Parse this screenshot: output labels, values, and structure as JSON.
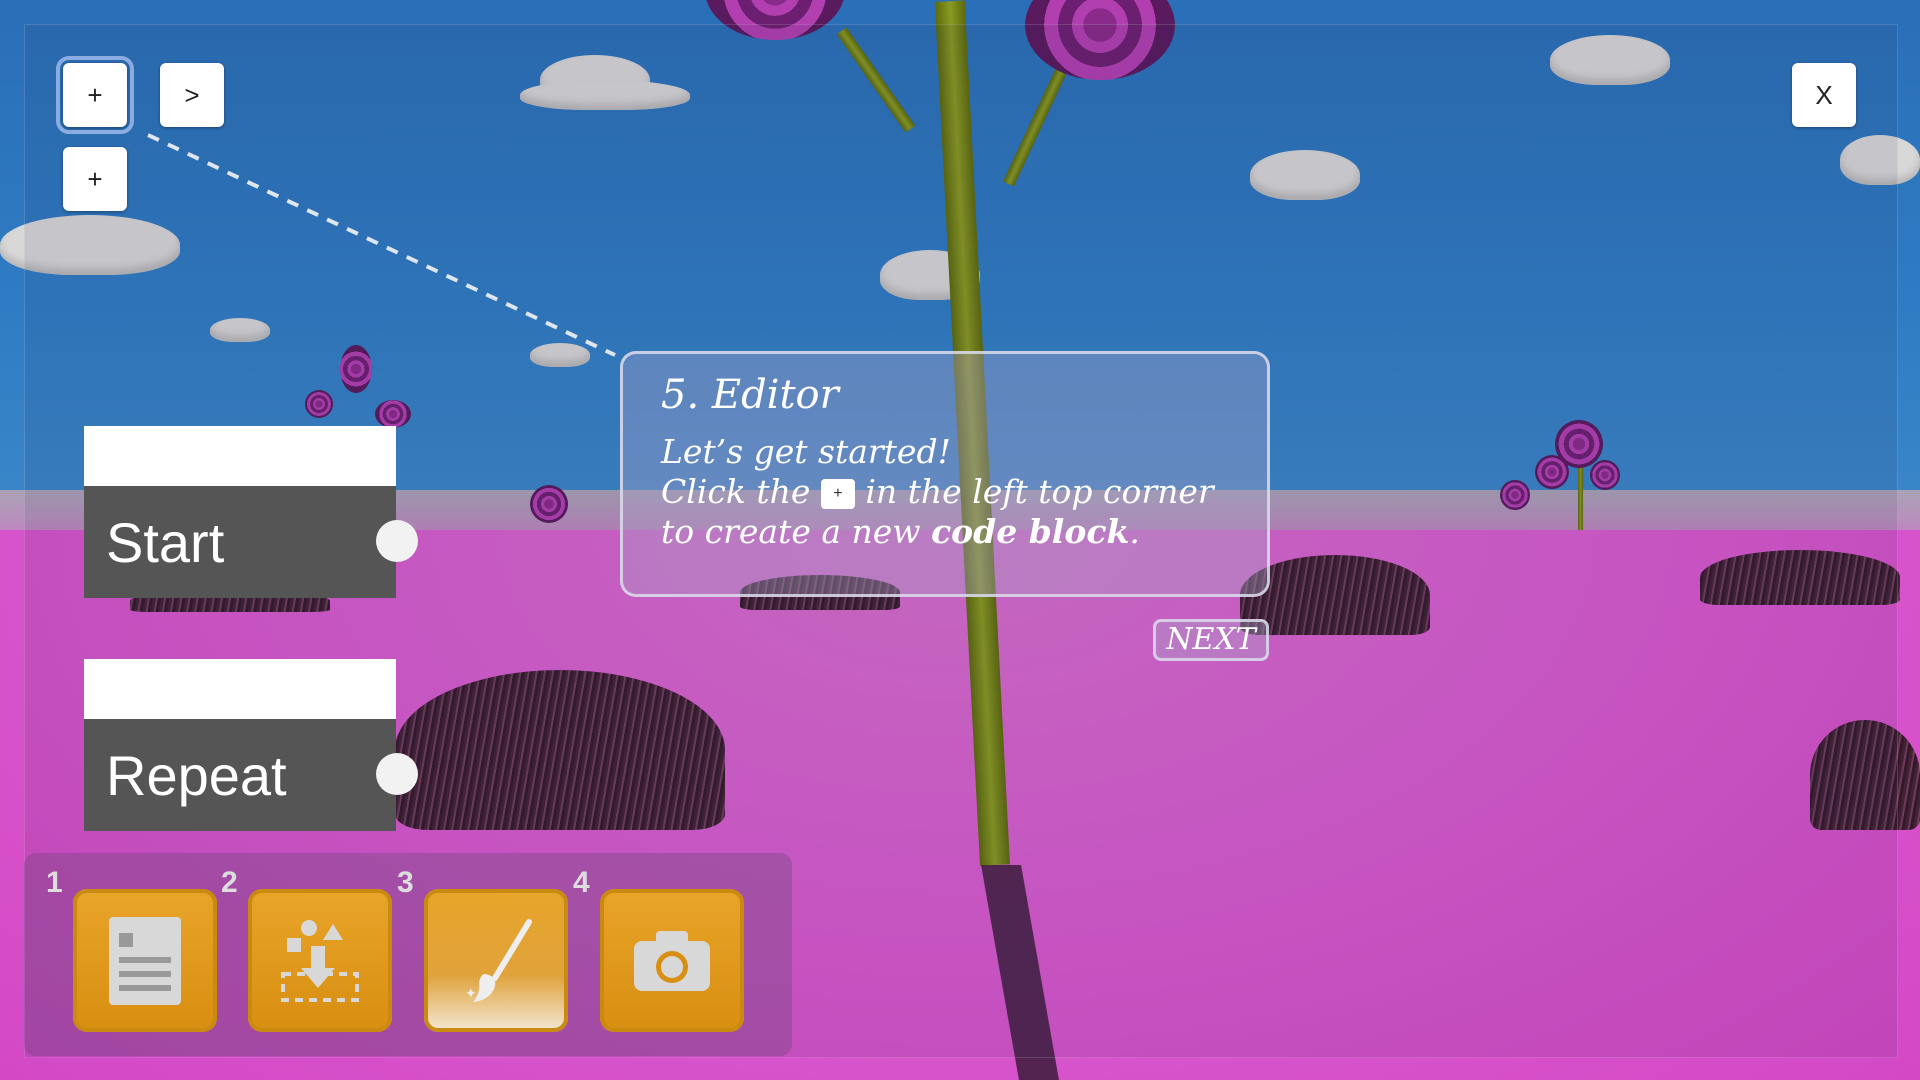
{
  "editor": {
    "add_button_label": "+",
    "next_button_label": ">",
    "add_button_2_label": "+",
    "close_button_label": "X"
  },
  "blocks": [
    {
      "label": "Start"
    },
    {
      "label": "Repeat"
    }
  ],
  "tutorial": {
    "title": "5. Editor",
    "line1": "Let’s get started!",
    "line2_pre": "Click the",
    "inline_icon": "+",
    "line2_post": "in the left top corner",
    "line3_pre": "to create a new",
    "line3_bold": "code block",
    "line3_post": ".",
    "next_label": "NEXT"
  },
  "toolbar": {
    "tools": [
      {
        "num": "1",
        "icon": "document-icon"
      },
      {
        "num": "2",
        "icon": "place-object-icon"
      },
      {
        "num": "3",
        "icon": "paint-brush-icon"
      },
      {
        "num": "4",
        "icon": "camera-icon"
      }
    ]
  }
}
